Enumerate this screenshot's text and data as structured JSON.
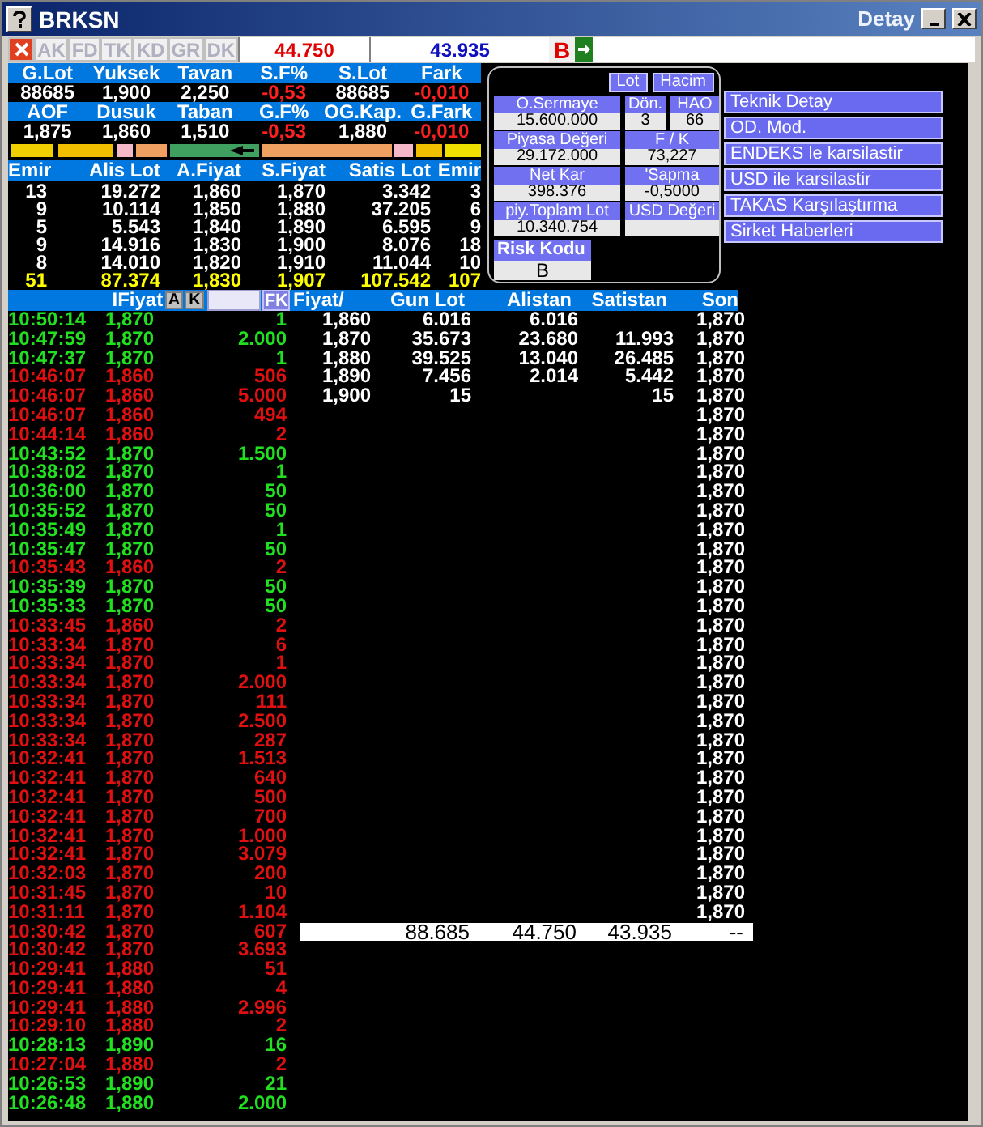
{
  "window": {
    "title": "BRKSN",
    "subtitle": "Detay"
  },
  "toolbar": {
    "tabs": [
      "AK",
      "FD",
      "TK",
      "KD",
      "GR",
      "DK"
    ],
    "sell_value": "44.750",
    "buy_value": "43.935",
    "flag": "B"
  },
  "stats": [
    {
      "kind": "header",
      "cells": [
        {
          "text": "G.Lot"
        },
        {
          "text": "Yuksek"
        },
        {
          "text": "Tavan"
        },
        {
          "text": "S.F%"
        },
        {
          "text": "S.Lot"
        },
        {
          "text": "Fark"
        }
      ]
    },
    {
      "kind": "values",
      "cells": [
        {
          "text": "88685",
          "negative": false
        },
        {
          "text": "1,900",
          "negative": false
        },
        {
          "text": "2,250",
          "negative": false
        },
        {
          "text": "-0,53",
          "negative": true
        },
        {
          "text": "88685",
          "negative": false
        },
        {
          "text": "-0,010",
          "negative": true
        }
      ]
    },
    {
      "kind": "header",
      "cells": [
        {
          "text": "AOF"
        },
        {
          "text": "Dusuk"
        },
        {
          "text": "Taban"
        },
        {
          "text": "G.F%"
        },
        {
          "text": "OG.Kap."
        },
        {
          "text": "G.Fark"
        }
      ]
    },
    {
      "kind": "values",
      "cells": [
        {
          "text": "1,875",
          "negative": false
        },
        {
          "text": "1,860",
          "negative": false
        },
        {
          "text": "1,510",
          "negative": false
        },
        {
          "text": "-0,53",
          "negative": true
        },
        {
          "text": "1,880",
          "negative": false
        },
        {
          "text": "-0,010",
          "negative": true
        }
      ]
    }
  ],
  "order_book": {
    "columns": [
      "Emir",
      "Alis Lot",
      "A.Fiyat",
      "S.Fiyat",
      "Satis Lot",
      "Emir"
    ],
    "rows": [
      [
        "13",
        "19.272",
        "1,860",
        "1,870",
        "3.342",
        "3"
      ],
      [
        "9",
        "10.114",
        "1,850",
        "1,880",
        "37.205",
        "6"
      ],
      [
        "5",
        "5.543",
        "1,840",
        "1,890",
        "6.595",
        "9"
      ],
      [
        "9",
        "14.916",
        "1,830",
        "1,900",
        "8.076",
        "18"
      ],
      [
        "8",
        "14.010",
        "1,820",
        "1,910",
        "11.044",
        "10"
      ]
    ],
    "total": [
      "51",
      "87.374",
      "1,830",
      "1,907",
      "107.542",
      "107"
    ]
  },
  "info_panel": {
    "toggles": [
      "Lot",
      "Hacim"
    ],
    "field_rows": [
      [
        {
          "label": "Ö.Sermaye",
          "value": "15.600.000"
        },
        {
          "label": "Dön.",
          "value": "3"
        },
        {
          "label": "HAO",
          "value": "66"
        }
      ],
      [
        {
          "label": "Piyasa Değeri",
          "value": "29.172.000"
        },
        {
          "label": "F / K",
          "value": "73,227"
        }
      ],
      [
        {
          "label": "Net Kar",
          "value": "398.376"
        },
        {
          "label": "'Sapma",
          "value": "-0,5000"
        }
      ],
      [
        {
          "label": "piy.Toplam Lot",
          "value": "10.340.754"
        },
        {
          "label": "USD Değeri"
        }
      ]
    ],
    "risk": {
      "label": "Risk Kodu",
      "value": "B"
    }
  },
  "links": [
    "Teknik Detay",
    "OD. Mod.",
    "ENDEKS le karsilastir",
    "USD ile karsilastir",
    "TAKAS Karşılaştırma",
    "Sirket Haberleri"
  ],
  "trades": {
    "price_label": "IFiyat",
    "buttons": [
      "A",
      "K"
    ],
    "filter_button": "FK",
    "rows": [
      {
        "time": "10:50:14",
        "price": "1,870",
        "lot": "1",
        "up": true
      },
      {
        "time": "10:47:59",
        "price": "1,870",
        "lot": "2.000",
        "up": true
      },
      {
        "time": "10:47:37",
        "price": "1,870",
        "lot": "1",
        "up": true
      },
      {
        "time": "10:46:07",
        "price": "1,860",
        "lot": "506",
        "up": false
      },
      {
        "time": "10:46:07",
        "price": "1,860",
        "lot": "5.000",
        "up": false
      },
      {
        "time": "10:46:07",
        "price": "1,860",
        "lot": "494",
        "up": false
      },
      {
        "time": "10:44:14",
        "price": "1,860",
        "lot": "2",
        "up": false
      },
      {
        "time": "10:43:52",
        "price": "1,870",
        "lot": "1.500",
        "up": true
      },
      {
        "time": "10:38:02",
        "price": "1,870",
        "lot": "1",
        "up": true
      },
      {
        "time": "10:36:00",
        "price": "1,870",
        "lot": "50",
        "up": true
      },
      {
        "time": "10:35:52",
        "price": "1,870",
        "lot": "50",
        "up": true
      },
      {
        "time": "10:35:49",
        "price": "1,870",
        "lot": "1",
        "up": true
      },
      {
        "time": "10:35:47",
        "price": "1,870",
        "lot": "50",
        "up": true
      },
      {
        "time": "10:35:43",
        "price": "1,860",
        "lot": "2",
        "up": false
      },
      {
        "time": "10:35:39",
        "price": "1,870",
        "lot": "50",
        "up": true
      },
      {
        "time": "10:35:33",
        "price": "1,870",
        "lot": "50",
        "up": true
      },
      {
        "time": "10:33:45",
        "price": "1,860",
        "lot": "2",
        "up": false
      },
      {
        "time": "10:33:34",
        "price": "1,870",
        "lot": "6",
        "up": false
      },
      {
        "time": "10:33:34",
        "price": "1,870",
        "lot": "1",
        "up": false
      },
      {
        "time": "10:33:34",
        "price": "1,870",
        "lot": "2.000",
        "up": false
      },
      {
        "time": "10:33:34",
        "price": "1,870",
        "lot": "111",
        "up": false
      },
      {
        "time": "10:33:34",
        "price": "1,870",
        "lot": "2.500",
        "up": false
      },
      {
        "time": "10:33:34",
        "price": "1,870",
        "lot": "287",
        "up": false
      },
      {
        "time": "10:32:41",
        "price": "1,870",
        "lot": "1.513",
        "up": false
      },
      {
        "time": "10:32:41",
        "price": "1,870",
        "lot": "640",
        "up": false
      },
      {
        "time": "10:32:41",
        "price": "1,870",
        "lot": "500",
        "up": false
      },
      {
        "time": "10:32:41",
        "price": "1,870",
        "lot": "700",
        "up": false
      },
      {
        "time": "10:32:41",
        "price": "1,870",
        "lot": "1.000",
        "up": false
      },
      {
        "time": "10:32:41",
        "price": "1,870",
        "lot": "3.079",
        "up": false
      },
      {
        "time": "10:32:03",
        "price": "1,870",
        "lot": "200",
        "up": false
      },
      {
        "time": "10:31:45",
        "price": "1,870",
        "lot": "10",
        "up": false
      },
      {
        "time": "10:31:11",
        "price": "1,870",
        "lot": "1.104",
        "up": false
      },
      {
        "time": "10:30:42",
        "price": "1,870",
        "lot": "607",
        "up": false
      },
      {
        "time": "10:30:42",
        "price": "1,870",
        "lot": "3.693",
        "up": false
      },
      {
        "time": "10:29:41",
        "price": "1,880",
        "lot": "51",
        "up": false
      },
      {
        "time": "10:29:41",
        "price": "1,880",
        "lot": "4",
        "up": false
      },
      {
        "time": "10:29:41",
        "price": "1,880",
        "lot": "2.996",
        "up": false
      },
      {
        "time": "10:29:10",
        "price": "1,880",
        "lot": "2",
        "up": false
      },
      {
        "time": "10:28:13",
        "price": "1,890",
        "lot": "16",
        "up": true
      },
      {
        "time": "10:27:04",
        "price": "1,880",
        "lot": "2",
        "up": false
      },
      {
        "time": "10:26:53",
        "price": "1,890",
        "lot": "21",
        "up": true
      },
      {
        "time": "10:26:48",
        "price": "1,880",
        "lot": "2.000",
        "up": true
      }
    ]
  },
  "price_table": {
    "columns": [
      "Fiyat/",
      "Gun Lot",
      "Alistan",
      "Satistan",
      "Son"
    ],
    "rows": [
      {
        "fiyat": "1,860",
        "gun_lot": "6.016",
        "alistan": "6.016",
        "son": "1,870"
      },
      {
        "fiyat": "1,870",
        "gun_lot": "35.673",
        "alistan": "23.680",
        "satistan": "11.993",
        "son": "1,870"
      },
      {
        "fiyat": "1,880",
        "gun_lot": "39.525",
        "alistan": "13.040",
        "satistan": "26.485",
        "son": "1,870"
      },
      {
        "fiyat": "1,890",
        "gun_lot": "7.456",
        "alistan": "2.014",
        "satistan": "5.442",
        "son": "1,870"
      },
      {
        "fiyat": "1,900",
        "gun_lot": "15",
        "satistan": "15",
        "son": "1,870"
      },
      {
        "son": "1,870"
      },
      {
        "son": "1,870"
      },
      {
        "son": "1,870"
      },
      {
        "son": "1,870"
      },
      {
        "son": "1,870"
      },
      {
        "son": "1,870"
      },
      {
        "son": "1,870"
      },
      {
        "son": "1,870"
      },
      {
        "son": "1,870"
      },
      {
        "son": "1,870"
      },
      {
        "son": "1,870"
      },
      {
        "son": "1,870"
      },
      {
        "son": "1,870"
      },
      {
        "son": "1,870"
      },
      {
        "son": "1,870"
      },
      {
        "son": "1,870"
      },
      {
        "son": "1,870"
      },
      {
        "son": "1,870"
      },
      {
        "son": "1,870"
      },
      {
        "son": "1,870"
      },
      {
        "son": "1,870"
      },
      {
        "son": "1,870"
      },
      {
        "son": "1,870"
      },
      {
        "son": "1,870"
      },
      {
        "son": "1,870"
      },
      {
        "son": "1,870"
      },
      {
        "son": "1,870"
      }
    ],
    "totals": {
      "gun_lot": "88.685",
      "alistan": "44.750",
      "satistan": "43.935",
      "son": "--"
    }
  }
}
